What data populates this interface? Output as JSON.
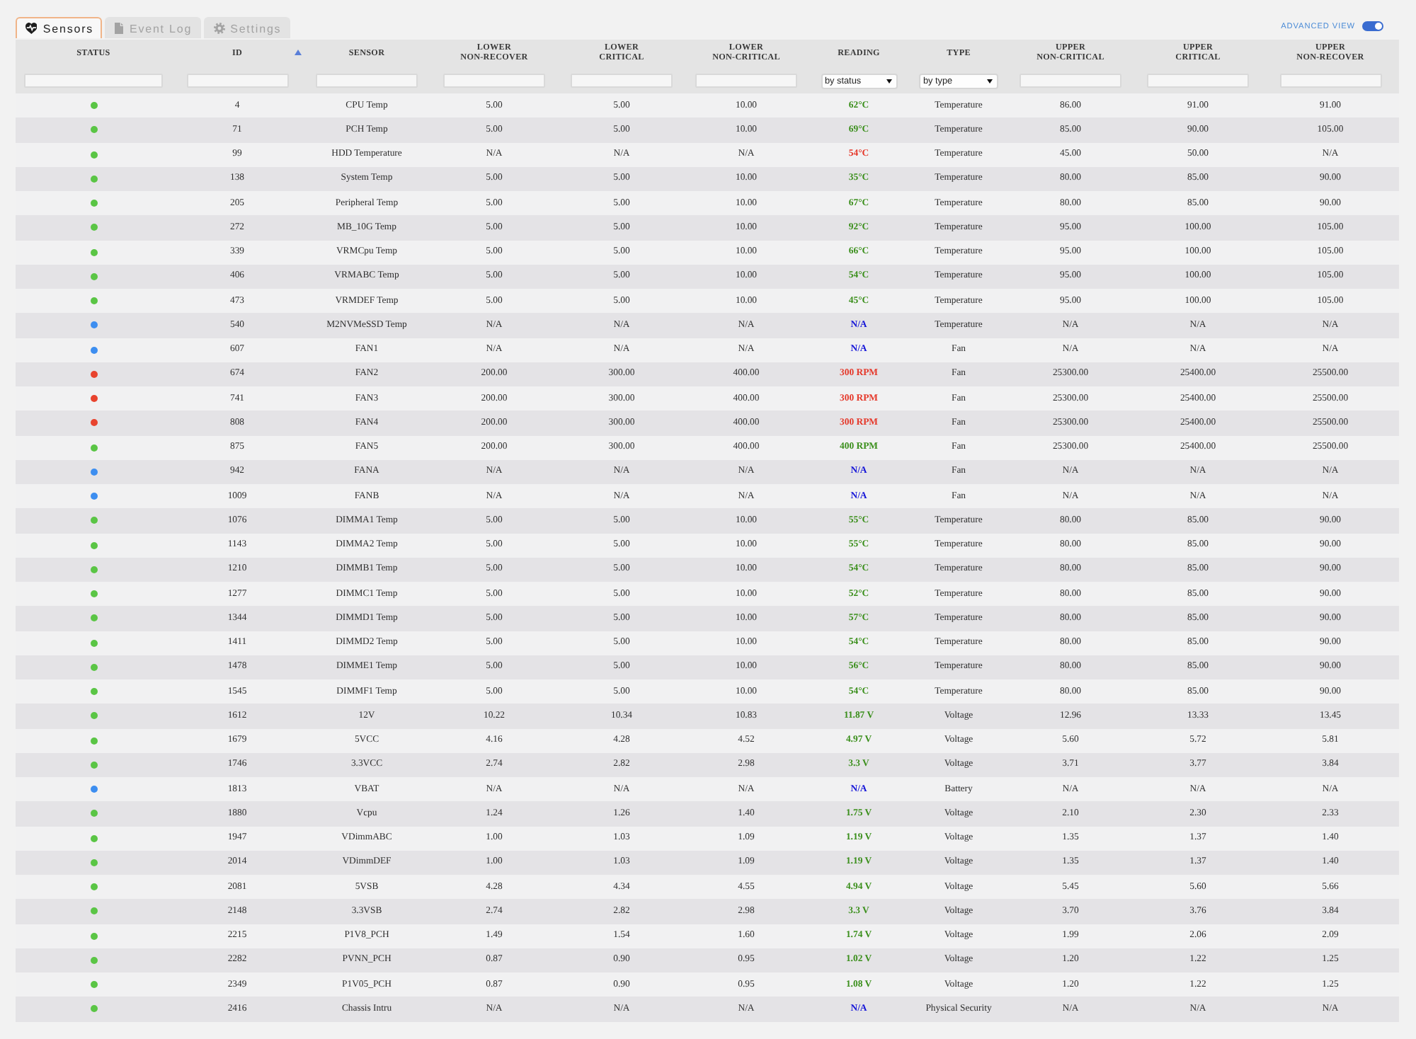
{
  "tabs": [
    {
      "label": "Sensors",
      "selected": true
    },
    {
      "label": "Event Log",
      "selected": false
    },
    {
      "label": "Settings",
      "selected": false
    }
  ],
  "advanced_view": {
    "label": "ADVANCED VIEW",
    "on": true
  },
  "table": {
    "columns": [
      {
        "label": "STATUS",
        "sorted": false,
        "filter": {
          "kind": "text"
        }
      },
      {
        "label": "ID",
        "sorted": true,
        "filter": {
          "kind": "text"
        }
      },
      {
        "label": "SENSOR",
        "sorted": false,
        "filter": {
          "kind": "text"
        }
      },
      {
        "label": "LOWER NON-RECOVER",
        "sorted": false,
        "filter": {
          "kind": "text"
        }
      },
      {
        "label": "LOWER CRITICAL",
        "sorted": false,
        "filter": {
          "kind": "text"
        }
      },
      {
        "label": "LOWER NON-CRITICAL",
        "sorted": false,
        "filter": {
          "kind": "text"
        }
      },
      {
        "label": "READING",
        "sorted": false,
        "filter": {
          "kind": "select",
          "value": "by status"
        }
      },
      {
        "label": "TYPE",
        "sorted": false,
        "filter": {
          "kind": "select",
          "value": "by type"
        }
      },
      {
        "label": "UPPER NON-CRITICAL",
        "sorted": false,
        "filter": {
          "kind": "text"
        }
      },
      {
        "label": "UPPER CRITICAL",
        "sorted": false,
        "filter": {
          "kind": "text"
        }
      },
      {
        "label": "UPPER NON-RECOVER",
        "sorted": false,
        "filter": {
          "kind": "text"
        }
      }
    ],
    "rows": [
      {
        "color": "#5ac545",
        "id": "4",
        "sensor": "CPU Temp",
        "lower_nr": "5.00",
        "lower_c": "5.00",
        "lower_nc": "10.00",
        "reading": {
          "text": "62°C",
          "color": "#3b8f1c"
        },
        "type": "Temperature",
        "upper_nc": "86.00",
        "upper_c": "91.00",
        "upper_nr": "91.00"
      },
      {
        "color": "#5ac545",
        "id": "71",
        "sensor": "PCH Temp",
        "lower_nr": "5.00",
        "lower_c": "5.00",
        "lower_nc": "10.00",
        "reading": {
          "text": "69°C",
          "color": "#3b8f1c"
        },
        "type": "Temperature",
        "upper_nc": "85.00",
        "upper_c": "90.00",
        "upper_nr": "105.00"
      },
      {
        "color": "#5ac545",
        "id": "99",
        "sensor": "HDD Temperature",
        "lower_nr": "N/A",
        "lower_c": "N/A",
        "lower_nc": "N/A",
        "reading": {
          "text": "54°C",
          "color": "#e5382a"
        },
        "type": "Temperature",
        "upper_nc": "45.00",
        "upper_c": "50.00",
        "upper_nr": "N/A"
      },
      {
        "color": "#5ac545",
        "id": "138",
        "sensor": "System Temp",
        "lower_nr": "5.00",
        "lower_c": "5.00",
        "lower_nc": "10.00",
        "reading": {
          "text": "35°C",
          "color": "#3b8f1c"
        },
        "type": "Temperature",
        "upper_nc": "80.00",
        "upper_c": "85.00",
        "upper_nr": "90.00"
      },
      {
        "color": "#5ac545",
        "id": "205",
        "sensor": "Peripheral Temp",
        "lower_nr": "5.00",
        "lower_c": "5.00",
        "lower_nc": "10.00",
        "reading": {
          "text": "67°C",
          "color": "#3b8f1c"
        },
        "type": "Temperature",
        "upper_nc": "80.00",
        "upper_c": "85.00",
        "upper_nr": "90.00"
      },
      {
        "color": "#5ac545",
        "id": "272",
        "sensor": "MB_10G Temp",
        "lower_nr": "5.00",
        "lower_c": "5.00",
        "lower_nc": "10.00",
        "reading": {
          "text": "92°C",
          "color": "#3b8f1c"
        },
        "type": "Temperature",
        "upper_nc": "95.00",
        "upper_c": "100.00",
        "upper_nr": "105.00"
      },
      {
        "color": "#5ac545",
        "id": "339",
        "sensor": "VRMCpu Temp",
        "lower_nr": "5.00",
        "lower_c": "5.00",
        "lower_nc": "10.00",
        "reading": {
          "text": "66°C",
          "color": "#3b8f1c"
        },
        "type": "Temperature",
        "upper_nc": "95.00",
        "upper_c": "100.00",
        "upper_nr": "105.00"
      },
      {
        "color": "#5ac545",
        "id": "406",
        "sensor": "VRMABC Temp",
        "lower_nr": "5.00",
        "lower_c": "5.00",
        "lower_nc": "10.00",
        "reading": {
          "text": "54°C",
          "color": "#3b8f1c"
        },
        "type": "Temperature",
        "upper_nc": "95.00",
        "upper_c": "100.00",
        "upper_nr": "105.00"
      },
      {
        "color": "#5ac545",
        "id": "473",
        "sensor": "VRMDEF Temp",
        "lower_nr": "5.00",
        "lower_c": "5.00",
        "lower_nc": "10.00",
        "reading": {
          "text": "45°C",
          "color": "#3b8f1c"
        },
        "type": "Temperature",
        "upper_nc": "95.00",
        "upper_c": "100.00",
        "upper_nr": "105.00"
      },
      {
        "color": "#3d8ef0",
        "id": "540",
        "sensor": "M2NVMeSSD Temp",
        "lower_nr": "N/A",
        "lower_c": "N/A",
        "lower_nc": "N/A",
        "reading": {
          "text": "N/A",
          "color": "#1616d8"
        },
        "type": "Temperature",
        "upper_nc": "N/A",
        "upper_c": "N/A",
        "upper_nr": "N/A"
      },
      {
        "color": "#3d8ef0",
        "id": "607",
        "sensor": "FAN1",
        "lower_nr": "N/A",
        "lower_c": "N/A",
        "lower_nc": "N/A",
        "reading": {
          "text": "N/A",
          "color": "#1616d8"
        },
        "type": "Fan",
        "upper_nc": "N/A",
        "upper_c": "N/A",
        "upper_nr": "N/A"
      },
      {
        "color": "#e8432e",
        "id": "674",
        "sensor": "FAN2",
        "lower_nr": "200.00",
        "lower_c": "300.00",
        "lower_nc": "400.00",
        "reading": {
          "text": "300 RPM",
          "color": "#e5382a"
        },
        "type": "Fan",
        "upper_nc": "25300.00",
        "upper_c": "25400.00",
        "upper_nr": "25500.00"
      },
      {
        "color": "#e8432e",
        "id": "741",
        "sensor": "FAN3",
        "lower_nr": "200.00",
        "lower_c": "300.00",
        "lower_nc": "400.00",
        "reading": {
          "text": "300 RPM",
          "color": "#e5382a"
        },
        "type": "Fan",
        "upper_nc": "25300.00",
        "upper_c": "25400.00",
        "upper_nr": "25500.00"
      },
      {
        "color": "#e8432e",
        "id": "808",
        "sensor": "FAN4",
        "lower_nr": "200.00",
        "lower_c": "300.00",
        "lower_nc": "400.00",
        "reading": {
          "text": "300 RPM",
          "color": "#e5382a"
        },
        "type": "Fan",
        "upper_nc": "25300.00",
        "upper_c": "25400.00",
        "upper_nr": "25500.00"
      },
      {
        "color": "#5ac545",
        "id": "875",
        "sensor": "FAN5",
        "lower_nr": "200.00",
        "lower_c": "300.00",
        "lower_nc": "400.00",
        "reading": {
          "text": "400 RPM",
          "color": "#3b8f1c"
        },
        "type": "Fan",
        "upper_nc": "25300.00",
        "upper_c": "25400.00",
        "upper_nr": "25500.00"
      },
      {
        "color": "#3d8ef0",
        "id": "942",
        "sensor": "FANA",
        "lower_nr": "N/A",
        "lower_c": "N/A",
        "lower_nc": "N/A",
        "reading": {
          "text": "N/A",
          "color": "#1616d8"
        },
        "type": "Fan",
        "upper_nc": "N/A",
        "upper_c": "N/A",
        "upper_nr": "N/A"
      },
      {
        "color": "#3d8ef0",
        "id": "1009",
        "sensor": "FANB",
        "lower_nr": "N/A",
        "lower_c": "N/A",
        "lower_nc": "N/A",
        "reading": {
          "text": "N/A",
          "color": "#1616d8"
        },
        "type": "Fan",
        "upper_nc": "N/A",
        "upper_c": "N/A",
        "upper_nr": "N/A"
      },
      {
        "color": "#5ac545",
        "id": "1076",
        "sensor": "DIMMA1 Temp",
        "lower_nr": "5.00",
        "lower_c": "5.00",
        "lower_nc": "10.00",
        "reading": {
          "text": "55°C",
          "color": "#3b8f1c"
        },
        "type": "Temperature",
        "upper_nc": "80.00",
        "upper_c": "85.00",
        "upper_nr": "90.00"
      },
      {
        "color": "#5ac545",
        "id": "1143",
        "sensor": "DIMMA2 Temp",
        "lower_nr": "5.00",
        "lower_c": "5.00",
        "lower_nc": "10.00",
        "reading": {
          "text": "55°C",
          "color": "#3b8f1c"
        },
        "type": "Temperature",
        "upper_nc": "80.00",
        "upper_c": "85.00",
        "upper_nr": "90.00"
      },
      {
        "color": "#5ac545",
        "id": "1210",
        "sensor": "DIMMB1 Temp",
        "lower_nr": "5.00",
        "lower_c": "5.00",
        "lower_nc": "10.00",
        "reading": {
          "text": "54°C",
          "color": "#3b8f1c"
        },
        "type": "Temperature",
        "upper_nc": "80.00",
        "upper_c": "85.00",
        "upper_nr": "90.00"
      },
      {
        "color": "#5ac545",
        "id": "1277",
        "sensor": "DIMMC1 Temp",
        "lower_nr": "5.00",
        "lower_c": "5.00",
        "lower_nc": "10.00",
        "reading": {
          "text": "52°C",
          "color": "#3b8f1c"
        },
        "type": "Temperature",
        "upper_nc": "80.00",
        "upper_c": "85.00",
        "upper_nr": "90.00"
      },
      {
        "color": "#5ac545",
        "id": "1344",
        "sensor": "DIMMD1 Temp",
        "lower_nr": "5.00",
        "lower_c": "5.00",
        "lower_nc": "10.00",
        "reading": {
          "text": "57°C",
          "color": "#3b8f1c"
        },
        "type": "Temperature",
        "upper_nc": "80.00",
        "upper_c": "85.00",
        "upper_nr": "90.00"
      },
      {
        "color": "#5ac545",
        "id": "1411",
        "sensor": "DIMMD2 Temp",
        "lower_nr": "5.00",
        "lower_c": "5.00",
        "lower_nc": "10.00",
        "reading": {
          "text": "54°C",
          "color": "#3b8f1c"
        },
        "type": "Temperature",
        "upper_nc": "80.00",
        "upper_c": "85.00",
        "upper_nr": "90.00"
      },
      {
        "color": "#5ac545",
        "id": "1478",
        "sensor": "DIMME1 Temp",
        "lower_nr": "5.00",
        "lower_c": "5.00",
        "lower_nc": "10.00",
        "reading": {
          "text": "56°C",
          "color": "#3b8f1c"
        },
        "type": "Temperature",
        "upper_nc": "80.00",
        "upper_c": "85.00",
        "upper_nr": "90.00"
      },
      {
        "color": "#5ac545",
        "id": "1545",
        "sensor": "DIMMF1 Temp",
        "lower_nr": "5.00",
        "lower_c": "5.00",
        "lower_nc": "10.00",
        "reading": {
          "text": "54°C",
          "color": "#3b8f1c"
        },
        "type": "Temperature",
        "upper_nc": "80.00",
        "upper_c": "85.00",
        "upper_nr": "90.00"
      },
      {
        "color": "#5ac545",
        "id": "1612",
        "sensor": "12V",
        "lower_nr": "10.22",
        "lower_c": "10.34",
        "lower_nc": "10.83",
        "reading": {
          "text": "11.87 V",
          "color": "#3b8f1c"
        },
        "type": "Voltage",
        "upper_nc": "12.96",
        "upper_c": "13.33",
        "upper_nr": "13.45"
      },
      {
        "color": "#5ac545",
        "id": "1679",
        "sensor": "5VCC",
        "lower_nr": "4.16",
        "lower_c": "4.28",
        "lower_nc": "4.52",
        "reading": {
          "text": "4.97 V",
          "color": "#3b8f1c"
        },
        "type": "Voltage",
        "upper_nc": "5.60",
        "upper_c": "5.72",
        "upper_nr": "5.81"
      },
      {
        "color": "#5ac545",
        "id": "1746",
        "sensor": "3.3VCC",
        "lower_nr": "2.74",
        "lower_c": "2.82",
        "lower_nc": "2.98",
        "reading": {
          "text": "3.3 V",
          "color": "#3b8f1c"
        },
        "type": "Voltage",
        "upper_nc": "3.71",
        "upper_c": "3.77",
        "upper_nr": "3.84"
      },
      {
        "color": "#3d8ef0",
        "id": "1813",
        "sensor": "VBAT",
        "lower_nr": "N/A",
        "lower_c": "N/A",
        "lower_nc": "N/A",
        "reading": {
          "text": "N/A",
          "color": "#1616d8"
        },
        "type": "Battery",
        "upper_nc": "N/A",
        "upper_c": "N/A",
        "upper_nr": "N/A"
      },
      {
        "color": "#5ac545",
        "id": "1880",
        "sensor": "Vcpu",
        "lower_nr": "1.24",
        "lower_c": "1.26",
        "lower_nc": "1.40",
        "reading": {
          "text": "1.75 V",
          "color": "#3b8f1c"
        },
        "type": "Voltage",
        "upper_nc": "2.10",
        "upper_c": "2.30",
        "upper_nr": "2.33"
      },
      {
        "color": "#5ac545",
        "id": "1947",
        "sensor": "VDimmABC",
        "lower_nr": "1.00",
        "lower_c": "1.03",
        "lower_nc": "1.09",
        "reading": {
          "text": "1.19 V",
          "color": "#3b8f1c"
        },
        "type": "Voltage",
        "upper_nc": "1.35",
        "upper_c": "1.37",
        "upper_nr": "1.40"
      },
      {
        "color": "#5ac545",
        "id": "2014",
        "sensor": "VDimmDEF",
        "lower_nr": "1.00",
        "lower_c": "1.03",
        "lower_nc": "1.09",
        "reading": {
          "text": "1.19 V",
          "color": "#3b8f1c"
        },
        "type": "Voltage",
        "upper_nc": "1.35",
        "upper_c": "1.37",
        "upper_nr": "1.40"
      },
      {
        "color": "#5ac545",
        "id": "2081",
        "sensor": "5VSB",
        "lower_nr": "4.28",
        "lower_c": "4.34",
        "lower_nc": "4.55",
        "reading": {
          "text": "4.94 V",
          "color": "#3b8f1c"
        },
        "type": "Voltage",
        "upper_nc": "5.45",
        "upper_c": "5.60",
        "upper_nr": "5.66"
      },
      {
        "color": "#5ac545",
        "id": "2148",
        "sensor": "3.3VSB",
        "lower_nr": "2.74",
        "lower_c": "2.82",
        "lower_nc": "2.98",
        "reading": {
          "text": "3.3 V",
          "color": "#3b8f1c"
        },
        "type": "Voltage",
        "upper_nc": "3.70",
        "upper_c": "3.76",
        "upper_nr": "3.84"
      },
      {
        "color": "#5ac545",
        "id": "2215",
        "sensor": "P1V8_PCH",
        "lower_nr": "1.49",
        "lower_c": "1.54",
        "lower_nc": "1.60",
        "reading": {
          "text": "1.74 V",
          "color": "#3b8f1c"
        },
        "type": "Voltage",
        "upper_nc": "1.99",
        "upper_c": "2.06",
        "upper_nr": "2.09"
      },
      {
        "color": "#5ac545",
        "id": "2282",
        "sensor": "PVNN_PCH",
        "lower_nr": "0.87",
        "lower_c": "0.90",
        "lower_nc": "0.95",
        "reading": {
          "text": "1.02 V",
          "color": "#3b8f1c"
        },
        "type": "Voltage",
        "upper_nc": "1.20",
        "upper_c": "1.22",
        "upper_nr": "1.25"
      },
      {
        "color": "#5ac545",
        "id": "2349",
        "sensor": "P1V05_PCH",
        "lower_nr": "0.87",
        "lower_c": "0.90",
        "lower_nc": "0.95",
        "reading": {
          "text": "1.08 V",
          "color": "#3b8f1c"
        },
        "type": "Voltage",
        "upper_nc": "1.20",
        "upper_c": "1.22",
        "upper_nr": "1.25"
      },
      {
        "color": "#5ac545",
        "id": "2416",
        "sensor": "Chassis Intru",
        "lower_nr": "N/A",
        "lower_c": "N/A",
        "lower_nc": "N/A",
        "reading": {
          "text": "N/A",
          "color": "#1616d8"
        },
        "type": "Physical Security",
        "upper_nc": "N/A",
        "upper_c": "N/A",
        "upper_nr": "N/A"
      }
    ]
  }
}
